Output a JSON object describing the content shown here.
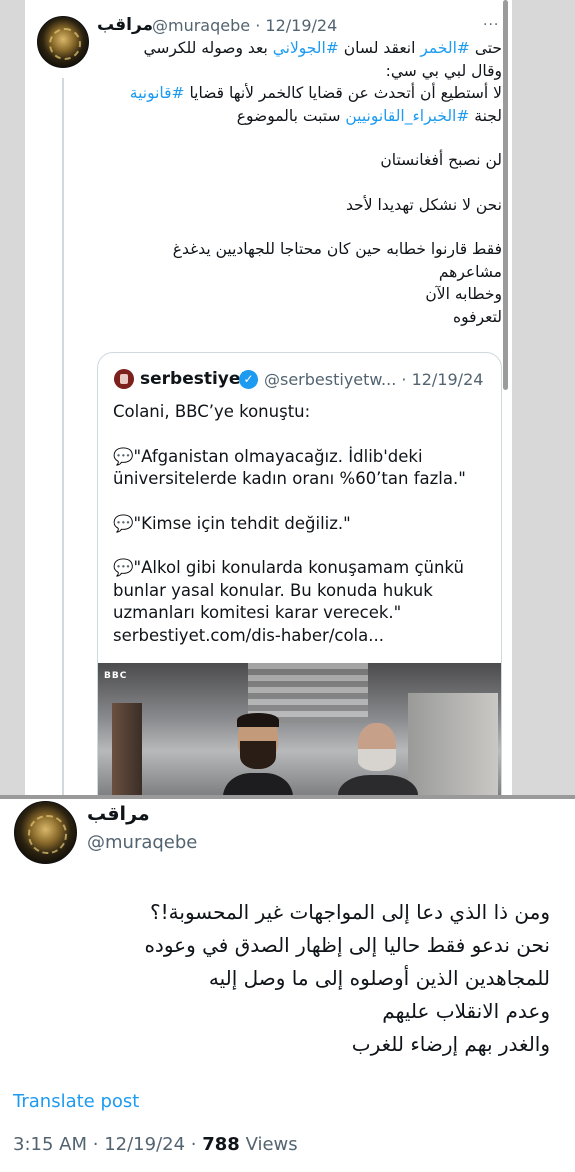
{
  "top_tweet": {
    "name": "مراقب",
    "handle": "@muraqebe",
    "dot": "·",
    "date": "12/19/24",
    "more": "···",
    "lines": [
      [
        {
          "t": "حتى "
        },
        {
          "t": "#الخمر",
          "h": true
        },
        {
          "t": " انعقد لسان "
        },
        {
          "t": "#الجولاني",
          "h": true
        },
        {
          "t": " بعد وصوله للكرسي"
        }
      ],
      [
        {
          "t": "وقال لبي بي سي:"
        }
      ],
      [
        {
          "t": "لا أستطيع أن أتحدث عن قضايا كالخمر لأنها قضايا "
        },
        {
          "t": "#قانونية",
          "h": true
        }
      ],
      [
        {
          "t": "لجنة "
        },
        {
          "t": "#الخبراء_القانونيين",
          "h": true
        },
        {
          "t": " ستبت بالموضوع"
        }
      ],
      [],
      [
        {
          "t": "لن نصبح أفغانستان"
        }
      ],
      [],
      [
        {
          "t": "نحن لا نشكل تهديدا لأحد"
        }
      ],
      [],
      [
        {
          "t": "فقط قارنوا خطابه حين كان محتاجا للجهاديين يدغدغ"
        }
      ],
      [
        {
          "t": "مشاعرهم"
        }
      ],
      [
        {
          "t": "وخطابه الآن"
        }
      ],
      [
        {
          "t": "لتعرفوه"
        }
      ]
    ]
  },
  "quote": {
    "name": "serbestiyet",
    "verified": "✓",
    "handle": "@serbestiyetw...",
    "dot": "·",
    "date": "12/19/24",
    "photo_logo": "BBC",
    "paragraphs": [
      [
        "Colani, BBC’ye konuştu:"
      ],
      [
        "💬\"Afganistan olmayacağız. İdlib'deki",
        "üniversitelerde kadın oranı %60’tan fazla.\""
      ],
      [
        "💬\"Kimse için tehdit değiliz.\""
      ],
      [
        "💬\"Alkol gibi konularda konuşamam çünkü",
        "bunlar yasal konular. Bu konuda hukuk",
        "uzmanları komitesi karar verecek.\"",
        "serbestiyet.com/dis-haber/cola..."
      ]
    ]
  },
  "bottom_tweet": {
    "name": "مراقب",
    "handle": "@muraqebe",
    "lines": [
      "ومن ذا الذي دعا إلى المواجهات غير المحسوبة!؟",
      "نحن ندعو فقط حاليا إلى إظهار الصدق في وعوده",
      "للمجاهدين الذين أوصلوه إلى ما وصل إليه",
      "وعدم الانقلاب عليهم",
      "والغدر بهم إرضاء للغرب"
    ],
    "translate": "Translate post",
    "time": "3:15 AM",
    "dot": "·",
    "date": "12/19/24",
    "dot2": "·",
    "views_count": "788",
    "views_label": "Views"
  },
  "colors": {
    "link": "#1d9bf0",
    "secondary": "#536471",
    "verified": "#1d9bf0"
  }
}
